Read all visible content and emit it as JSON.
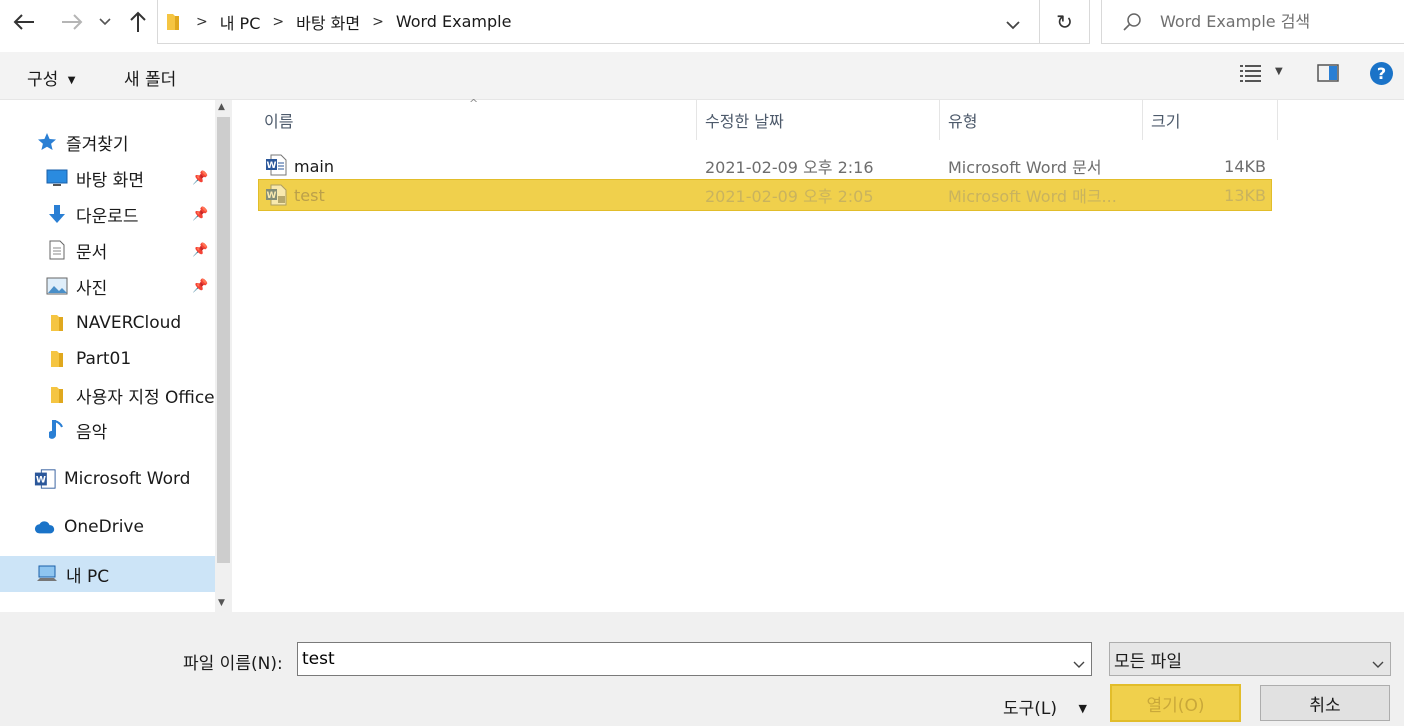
{
  "address": {
    "breadcrumbs": [
      "내 PC",
      "바탕 화면",
      "Word Example"
    ],
    "search_placeholder": "Word Example 검색"
  },
  "toolbar": {
    "organize_label": "구성",
    "new_folder_label": "새 폴더"
  },
  "sidebar": {
    "quick_access": "즐겨찾기",
    "items": [
      {
        "label": "바탕 화면",
        "icon": "desktop-icon",
        "pinned": true
      },
      {
        "label": "다운로드",
        "icon": "download-arrow-icon",
        "pinned": true
      },
      {
        "label": "문서",
        "icon": "document-icon",
        "pinned": true
      },
      {
        "label": "사진",
        "icon": "picture-icon",
        "pinned": true
      },
      {
        "label": "NAVERCloud",
        "icon": "folder-icon",
        "pinned": false
      },
      {
        "label": "Part01",
        "icon": "folder-icon",
        "pinned": false
      },
      {
        "label": "사용자 지정 Office",
        "icon": "folder-icon",
        "pinned": false
      },
      {
        "label": "음악",
        "icon": "music-note-icon",
        "pinned": false
      }
    ],
    "microsoft_word": "Microsoft Word",
    "onedrive": "OneDrive",
    "this_pc": "내 PC"
  },
  "columns": {
    "name": "이름",
    "modified": "수정한 날짜",
    "type": "유형",
    "size": "크기"
  },
  "files": [
    {
      "name": "main",
      "modified": "2021-02-09 오후 2:16",
      "type": "Microsoft Word 문서",
      "size": "14KB",
      "selected": false
    },
    {
      "name": "test",
      "modified": "2021-02-09 오후 2:05",
      "type": "Microsoft Word 매크...",
      "size": "13KB",
      "selected": true
    }
  ],
  "bottom": {
    "filename_label": "파일 이름(N):",
    "filename_value": "test",
    "filetype_value": "모든 파일",
    "tools_label": "도구(L)",
    "open_label": "열기(O)",
    "cancel_label": "취소"
  },
  "colors": {
    "selection": "#f0d04c",
    "accent_blue": "#1a73c8",
    "folder_yellow": "#f5c542"
  }
}
